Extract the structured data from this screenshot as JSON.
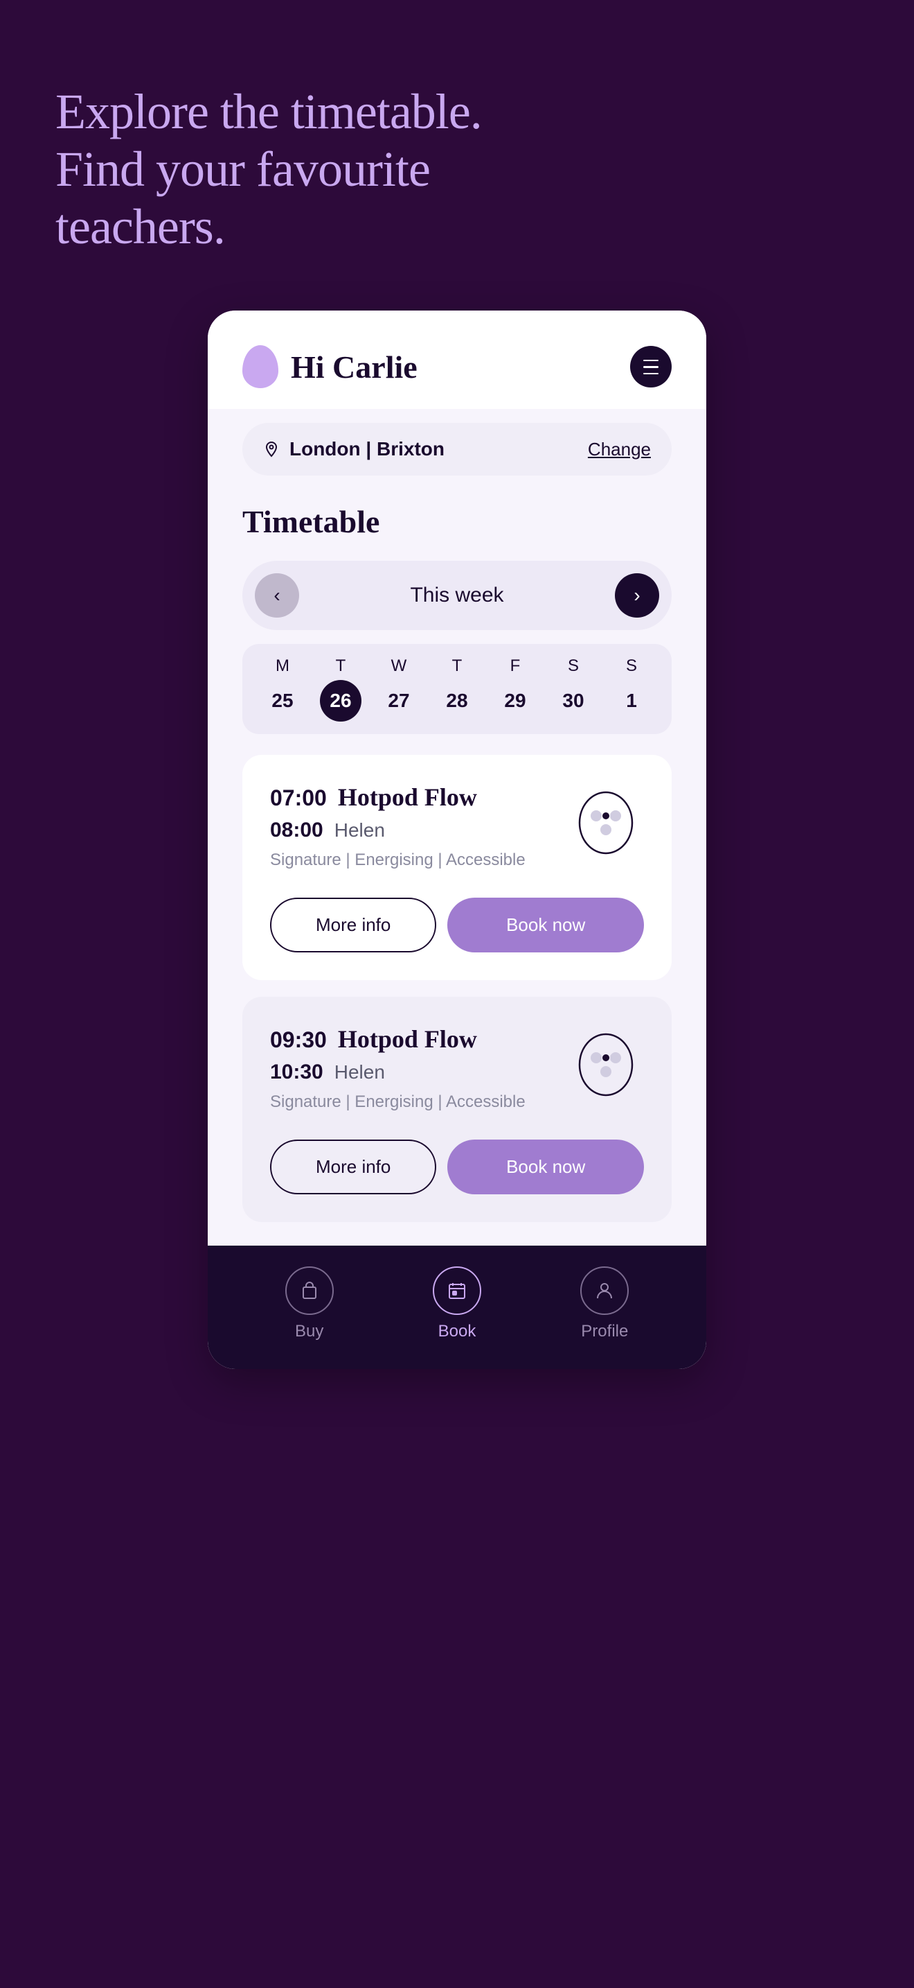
{
  "hero": {
    "line1": "Explore the timetable.",
    "line2": "Find your favourite teachers."
  },
  "header": {
    "greeting": "Hi Carlie",
    "menu_label": "menu"
  },
  "location": {
    "text": "London | Brixton",
    "change_label": "Change"
  },
  "timetable": {
    "title": "Timetable",
    "week_label": "This week",
    "days": [
      {
        "letter": "M",
        "number": "25",
        "active": false
      },
      {
        "letter": "T",
        "number": "26",
        "active": true
      },
      {
        "letter": "W",
        "number": "27",
        "active": false
      },
      {
        "letter": "T",
        "number": "28",
        "active": false
      },
      {
        "letter": "F",
        "number": "29",
        "active": false
      },
      {
        "letter": "S",
        "number": "30",
        "active": false
      },
      {
        "letter": "S",
        "number": "1",
        "active": false
      }
    ]
  },
  "classes": [
    {
      "start_time": "07:00",
      "name": "Hotpod Flow",
      "end_time": "08:00",
      "teacher": "Helen",
      "tags": "Signature | Energising | Accessible",
      "more_info": "More info",
      "book_now": "Book now"
    },
    {
      "start_time": "09:30",
      "name": "Hotpod Flow",
      "end_time": "10:30",
      "teacher": "Helen",
      "tags": "Signature | Energising | Accessible",
      "more_info": "More info",
      "book_now": "Book now"
    }
  ],
  "bottom_nav": [
    {
      "label": "Buy",
      "icon": "bag-icon",
      "active": false
    },
    {
      "label": "Book",
      "icon": "calendar-icon",
      "active": true
    },
    {
      "label": "Profile",
      "icon": "person-icon",
      "active": false
    }
  ]
}
